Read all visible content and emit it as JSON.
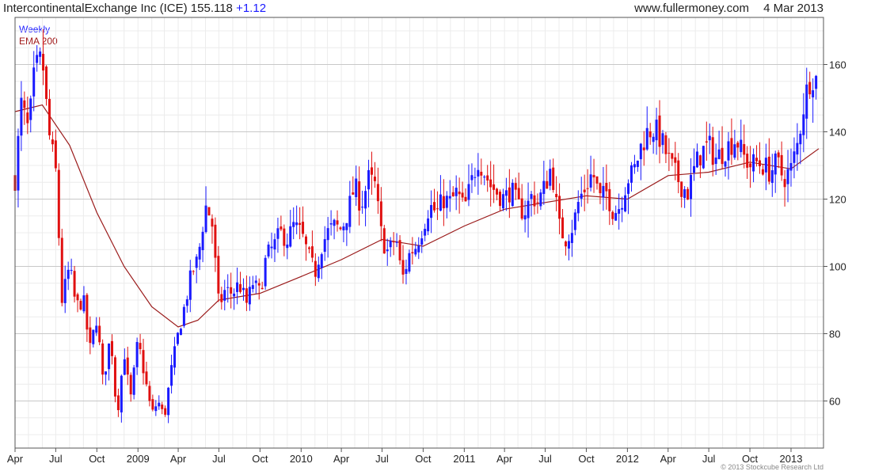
{
  "header": {
    "title": "IntercontinentalExchange Inc (ICE) 155.118",
    "change": "+1.12",
    "site": "www.fullermoney.com",
    "date": "4 Mar 2013"
  },
  "legend": {
    "weekly": "Weekly",
    "ema": "EMA 200"
  },
  "copyright": "© 2013 Stockcube Research Ltd",
  "colors": {
    "up": "#1a1aff",
    "down": "#e01010",
    "ema": "#9a1a1a",
    "grid": "#c8c8c8",
    "frame": "#555555"
  },
  "chart_data": {
    "type": "candlestick",
    "title": "IntercontinentalExchange Inc (ICE) 155.118 +1.12",
    "frequency": "Weekly",
    "x_start": "2008-04-01",
    "x_end": "2013-03-04",
    "ylim": [
      46,
      174
    ],
    "y_ticks": [
      60,
      80,
      100,
      120,
      140,
      160
    ],
    "y_axis_side": "right",
    "grid": true,
    "x_tick_labels": [
      {
        "date": "2008-04-01",
        "label": "Apr"
      },
      {
        "date": "2008-07-01",
        "label": "Jul"
      },
      {
        "date": "2008-10-01",
        "label": "Oct"
      },
      {
        "date": "2009-01-01",
        "label": "2009"
      },
      {
        "date": "2009-04-01",
        "label": "Apr"
      },
      {
        "date": "2009-07-01",
        "label": "Jul"
      },
      {
        "date": "2009-10-01",
        "label": "Oct"
      },
      {
        "date": "2010-01-01",
        "label": "2010"
      },
      {
        "date": "2010-04-01",
        "label": "Apr"
      },
      {
        "date": "2010-07-01",
        "label": "Jul"
      },
      {
        "date": "2010-10-01",
        "label": "Oct"
      },
      {
        "date": "2011-01-01",
        "label": "2011"
      },
      {
        "date": "2011-04-01",
        "label": "Apr"
      },
      {
        "date": "2011-07-01",
        "label": "Jul"
      },
      {
        "date": "2011-10-01",
        "label": "Oct"
      },
      {
        "date": "2012-01-01",
        "label": "2012"
      },
      {
        "date": "2012-04-01",
        "label": "Apr"
      },
      {
        "date": "2012-07-01",
        "label": "Jul"
      },
      {
        "date": "2012-10-01",
        "label": "Oct"
      },
      {
        "date": "2013-01-01",
        "label": "2013"
      }
    ],
    "price_series": [
      [
        "2008-04-01",
        126
      ],
      [
        "2008-04-15",
        148
      ],
      [
        "2008-05-01",
        140
      ],
      [
        "2008-05-15",
        158
      ],
      [
        "2008-06-01",
        162
      ],
      [
        "2008-06-15",
        140
      ],
      [
        "2008-07-01",
        128
      ],
      [
        "2008-07-15",
        90
      ],
      [
        "2008-08-01",
        100
      ],
      [
        "2008-08-15",
        88
      ],
      [
        "2008-09-01",
        90
      ],
      [
        "2008-09-15",
        75
      ],
      [
        "2008-10-01",
        85
      ],
      [
        "2008-10-15",
        65
      ],
      [
        "2008-11-01",
        80
      ],
      [
        "2008-11-15",
        55
      ],
      [
        "2008-12-01",
        75
      ],
      [
        "2008-12-15",
        60
      ],
      [
        "2009-01-01",
        78
      ],
      [
        "2009-01-15",
        68
      ],
      [
        "2009-02-01",
        56
      ],
      [
        "2009-02-15",
        60
      ],
      [
        "2009-03-01",
        55
      ],
      [
        "2009-03-15",
        68
      ],
      [
        "2009-04-01",
        80
      ],
      [
        "2009-04-15",
        88
      ],
      [
        "2009-05-01",
        98
      ],
      [
        "2009-05-15",
        102
      ],
      [
        "2009-06-01",
        118
      ],
      [
        "2009-06-15",
        114
      ],
      [
        "2009-07-01",
        88
      ],
      [
        "2009-07-15",
        93
      ],
      [
        "2009-08-01",
        92
      ],
      [
        "2009-08-15",
        95
      ],
      [
        "2009-09-01",
        89
      ],
      [
        "2009-09-15",
        95
      ],
      [
        "2009-10-01",
        92
      ],
      [
        "2009-10-15",
        103
      ],
      [
        "2009-11-01",
        106
      ],
      [
        "2009-11-15",
        110
      ],
      [
        "2009-12-01",
        108
      ],
      [
        "2009-12-15",
        112
      ],
      [
        "2010-01-01",
        110
      ],
      [
        "2010-01-15",
        104
      ],
      [
        "2010-02-01",
        98
      ],
      [
        "2010-02-15",
        106
      ],
      [
        "2010-03-01",
        110
      ],
      [
        "2010-03-15",
        112
      ],
      [
        "2010-04-01",
        111
      ],
      [
        "2010-04-15",
        116
      ],
      [
        "2010-05-01",
        124
      ],
      [
        "2010-05-15",
        118
      ],
      [
        "2010-06-01",
        126
      ],
      [
        "2010-06-15",
        124
      ],
      [
        "2010-07-01",
        108
      ],
      [
        "2010-07-15",
        104
      ],
      [
        "2010-08-01",
        109
      ],
      [
        "2010-08-15",
        96
      ],
      [
        "2010-09-01",
        104
      ],
      [
        "2010-09-15",
        106
      ],
      [
        "2010-10-01",
        112
      ],
      [
        "2010-10-15",
        118
      ],
      [
        "2010-11-01",
        116
      ],
      [
        "2010-11-15",
        120
      ],
      [
        "2010-12-01",
        119
      ],
      [
        "2010-12-15",
        122
      ],
      [
        "2011-01-01",
        117
      ],
      [
        "2011-01-15",
        124
      ],
      [
        "2011-02-01",
        132
      ],
      [
        "2011-02-15",
        128
      ],
      [
        "2011-03-01",
        124
      ],
      [
        "2011-03-15",
        122
      ],
      [
        "2011-04-01",
        120
      ],
      [
        "2011-04-15",
        123
      ],
      [
        "2011-05-01",
        118
      ],
      [
        "2011-05-15",
        116
      ],
      [
        "2011-06-01",
        121
      ],
      [
        "2011-06-15",
        119
      ],
      [
        "2011-07-01",
        124
      ],
      [
        "2011-07-15",
        130
      ],
      [
        "2011-08-01",
        112
      ],
      [
        "2011-08-15",
        108
      ],
      [
        "2011-09-01",
        112
      ],
      [
        "2011-09-15",
        120
      ],
      [
        "2011-10-01",
        124
      ],
      [
        "2011-10-15",
        128
      ],
      [
        "2011-11-01",
        120
      ],
      [
        "2011-11-15",
        122
      ],
      [
        "2011-12-01",
        116
      ],
      [
        "2011-12-15",
        118
      ],
      [
        "2012-01-01",
        126
      ],
      [
        "2012-01-15",
        128
      ],
      [
        "2012-02-01",
        136
      ],
      [
        "2012-02-15",
        140
      ],
      [
        "2012-03-01",
        141
      ],
      [
        "2012-03-15",
        138
      ],
      [
        "2012-04-01",
        132
      ],
      [
        "2012-04-15",
        128
      ],
      [
        "2012-05-01",
        124
      ],
      [
        "2012-05-15",
        122
      ],
      [
        "2012-06-01",
        130
      ],
      [
        "2012-06-15",
        134
      ],
      [
        "2012-07-01",
        136
      ],
      [
        "2012-07-15",
        132
      ],
      [
        "2012-08-01",
        134
      ],
      [
        "2012-08-15",
        136
      ],
      [
        "2012-09-01",
        138
      ],
      [
        "2012-09-15",
        133
      ],
      [
        "2012-10-01",
        130
      ],
      [
        "2012-10-15",
        131
      ],
      [
        "2012-11-01",
        130
      ],
      [
        "2012-11-15",
        128
      ],
      [
        "2012-12-01",
        131
      ],
      [
        "2012-12-15",
        126
      ],
      [
        "2013-01-01",
        129
      ],
      [
        "2013-01-15",
        136
      ],
      [
        "2013-02-01",
        150
      ],
      [
        "2013-02-15",
        157
      ],
      [
        "2013-03-04",
        155.118
      ]
    ],
    "ema_200": [
      [
        "2008-04-01",
        146
      ],
      [
        "2008-06-01",
        148
      ],
      [
        "2008-08-01",
        136
      ],
      [
        "2008-10-01",
        116
      ],
      [
        "2008-12-01",
        100
      ],
      [
        "2009-02-01",
        88
      ],
      [
        "2009-04-01",
        82
      ],
      [
        "2009-05-15",
        84
      ],
      [
        "2009-07-01",
        90
      ],
      [
        "2009-10-01",
        92
      ],
      [
        "2010-01-01",
        97
      ],
      [
        "2010-04-01",
        102
      ],
      [
        "2010-07-01",
        108
      ],
      [
        "2010-10-01",
        106
      ],
      [
        "2011-01-01",
        112
      ],
      [
        "2011-04-01",
        117
      ],
      [
        "2011-07-01",
        119
      ],
      [
        "2011-10-01",
        121
      ],
      [
        "2012-01-01",
        120
      ],
      [
        "2012-04-01",
        127
      ],
      [
        "2012-07-01",
        128
      ],
      [
        "2012-10-01",
        131
      ],
      [
        "2013-01-01",
        129
      ],
      [
        "2013-03-04",
        135
      ]
    ]
  }
}
